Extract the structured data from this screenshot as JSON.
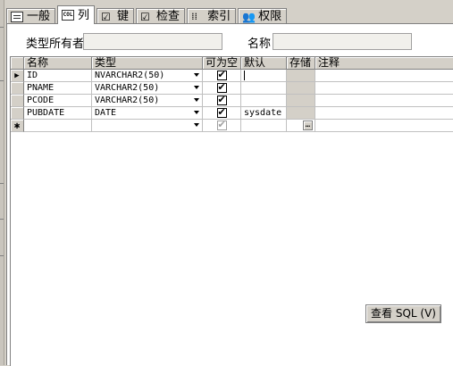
{
  "tabs": [
    {
      "label": "一般",
      "icon": "general-icon"
    },
    {
      "label": "列",
      "icon": "column-icon",
      "active": true
    },
    {
      "label": "键",
      "icon": "key-icon"
    },
    {
      "label": "检查",
      "icon": "check-icon"
    },
    {
      "label": "索引",
      "icon": "index-icon"
    },
    {
      "label": "权限",
      "icon": "permission-icon"
    }
  ],
  "form": {
    "owner_label": "类型所有者",
    "owner_value": "",
    "name_label": "名称",
    "name_value": ""
  },
  "grid": {
    "headers": [
      "名称",
      "类型",
      "可为空",
      "默认",
      "存储",
      "注释"
    ],
    "rows": [
      {
        "name": "ID",
        "type": "NVARCHAR2(50)",
        "nullable": true,
        "default": "",
        "comment": ""
      },
      {
        "name": "PNAME",
        "type": "VARCHAR2(50)",
        "nullable": true,
        "default": "",
        "comment": ""
      },
      {
        "name": "PCODE",
        "type": "VARCHAR2(50)",
        "nullable": true,
        "default": "",
        "comment": ""
      },
      {
        "name": "PUBDATE",
        "type": "DATE",
        "nullable": true,
        "default": "sysdate",
        "comment": ""
      }
    ],
    "new_row_marker": "✱",
    "current_row_marker": "▶",
    "storage_button": "…"
  },
  "buttons": {
    "view_sql": "查看 SQL (V)"
  },
  "colors": {
    "window_bg": "#d4d0c8",
    "panel_bg": "#ffffff",
    "field_bg": "#f1f0ec"
  }
}
